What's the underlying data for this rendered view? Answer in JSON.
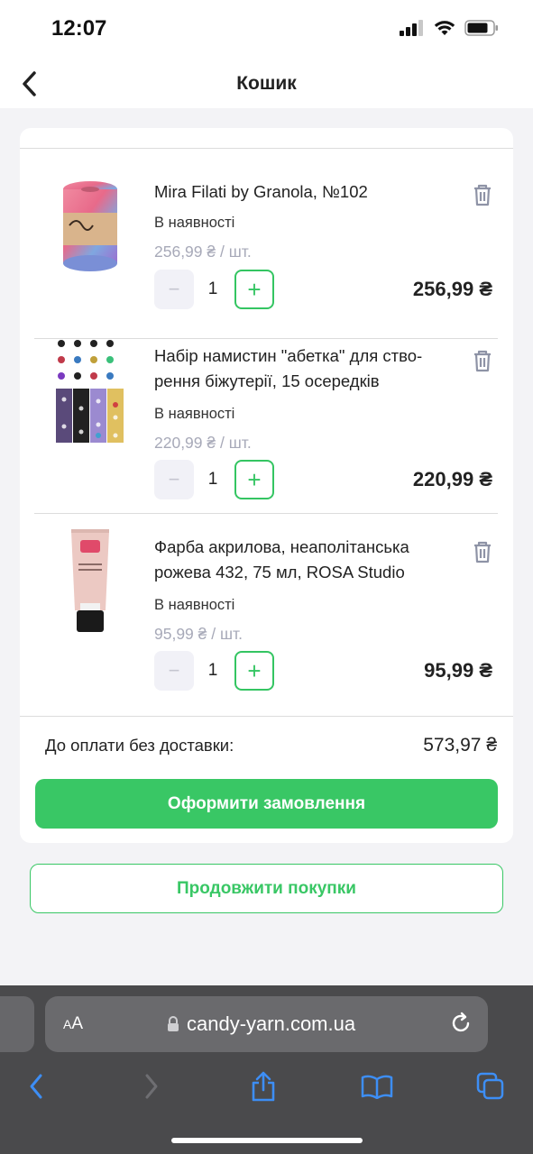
{
  "status_bar": {
    "time": "12:07"
  },
  "header": {
    "title": "Кошик"
  },
  "items": [
    {
      "title": "Mira Filati by Granola, №102",
      "stock": "В наявності",
      "unit_price": "256,99 ₴ / шт.",
      "qty_minus": "−",
      "qty": "1",
      "qty_plus": "+",
      "total": "256,99 ₴"
    },
    {
      "title": "Набір намистин \"абетка\" для ство-ренння біжутерії, 15 осередків",
      "title_line1": "Набір намистин \"абетка\" для ство-",
      "title_line2": "рення біжутерії, 15 осередків",
      "stock": "В наявності",
      "unit_price": "220,99 ₴ / шт.",
      "qty_minus": "−",
      "qty": "1",
      "qty_plus": "+",
      "total": "220,99 ₴"
    },
    {
      "title_line1": "Фарба акрилова, неаполітанська",
      "title_line2": "рожева 432, 75 мл, ROSA Studio",
      "stock": "В наявності",
      "unit_price": "95,99 ₴ / шт.",
      "qty_minus": "−",
      "qty": "1",
      "qty_plus": "+",
      "total": "95,99 ₴"
    }
  ],
  "summary": {
    "label": "До оплати без доставки:",
    "value": "573,97 ₴"
  },
  "buttons": {
    "checkout": "Оформити замовлення",
    "continue": "Продовжити покупки"
  },
  "browser": {
    "aa_small": "A",
    "aa_large": "A",
    "url": "candy-yarn.com.ua"
  },
  "colors": {
    "accent": "#39c765",
    "muted_price": "#a7a9b8",
    "browser_bg": "#4a4a4c",
    "link_blue": "#3d8ef5"
  }
}
